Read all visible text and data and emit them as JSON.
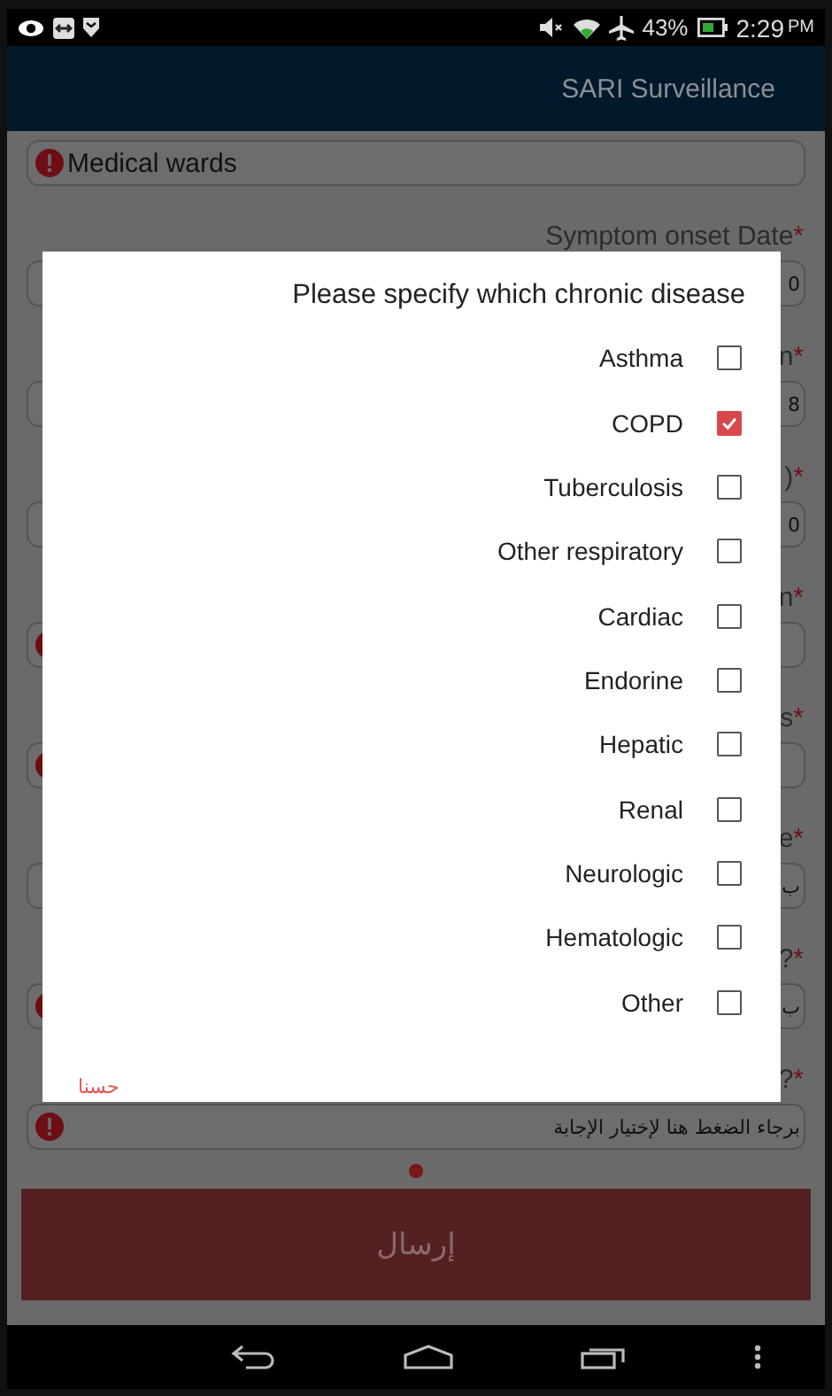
{
  "status_bar": {
    "battery": "43%",
    "time": "2:29",
    "time_suffix": "PM"
  },
  "app_bar": {
    "title": "SARI Surveillance"
  },
  "form": {
    "rows": [
      {
        "label": null,
        "value": "Medical wards",
        "error": true
      },
      {
        "label": "Symptom onset Date",
        "required_mark": "*",
        "value": "0",
        "error": false
      },
      {
        "label": "n",
        "required_mark": "*",
        "value": "8",
        "error": false
      },
      {
        "label": ")",
        "required_mark": "*",
        "value": "0",
        "error": false
      },
      {
        "label": "n",
        "required_mark": "*",
        "value": null,
        "error": true
      },
      {
        "label": "s",
        "required_mark": "*",
        "value": null,
        "error": true
      },
      {
        "label": "e",
        "required_mark": "*",
        "value": "ب",
        "error": false
      },
      {
        "label": "?",
        "required_mark": "*",
        "value": "ب",
        "error": true
      },
      {
        "label": "?",
        "required_mark": "*",
        "value": "برجاء الضغط هنا لإختيار الإجابة",
        "error": true
      }
    ],
    "submit": "إرسال"
  },
  "dialog": {
    "title": "Please specify which chronic disease",
    "options": [
      {
        "label": "Asthma",
        "checked": false
      },
      {
        "label": "COPD",
        "checked": true
      },
      {
        "label": "Tuberculosis",
        "checked": false
      },
      {
        "label": "Other respiratory",
        "checked": false
      },
      {
        "label": "Cardiac",
        "checked": false
      },
      {
        "label": "Endorine",
        "checked": false
      },
      {
        "label": "Hepatic",
        "checked": false
      },
      {
        "label": "Renal",
        "checked": false
      },
      {
        "label": "Neurologic",
        "checked": false
      },
      {
        "label": "Hematologic",
        "checked": false
      },
      {
        "label": "Other",
        "checked": false
      }
    ],
    "ok": "حسنا"
  }
}
